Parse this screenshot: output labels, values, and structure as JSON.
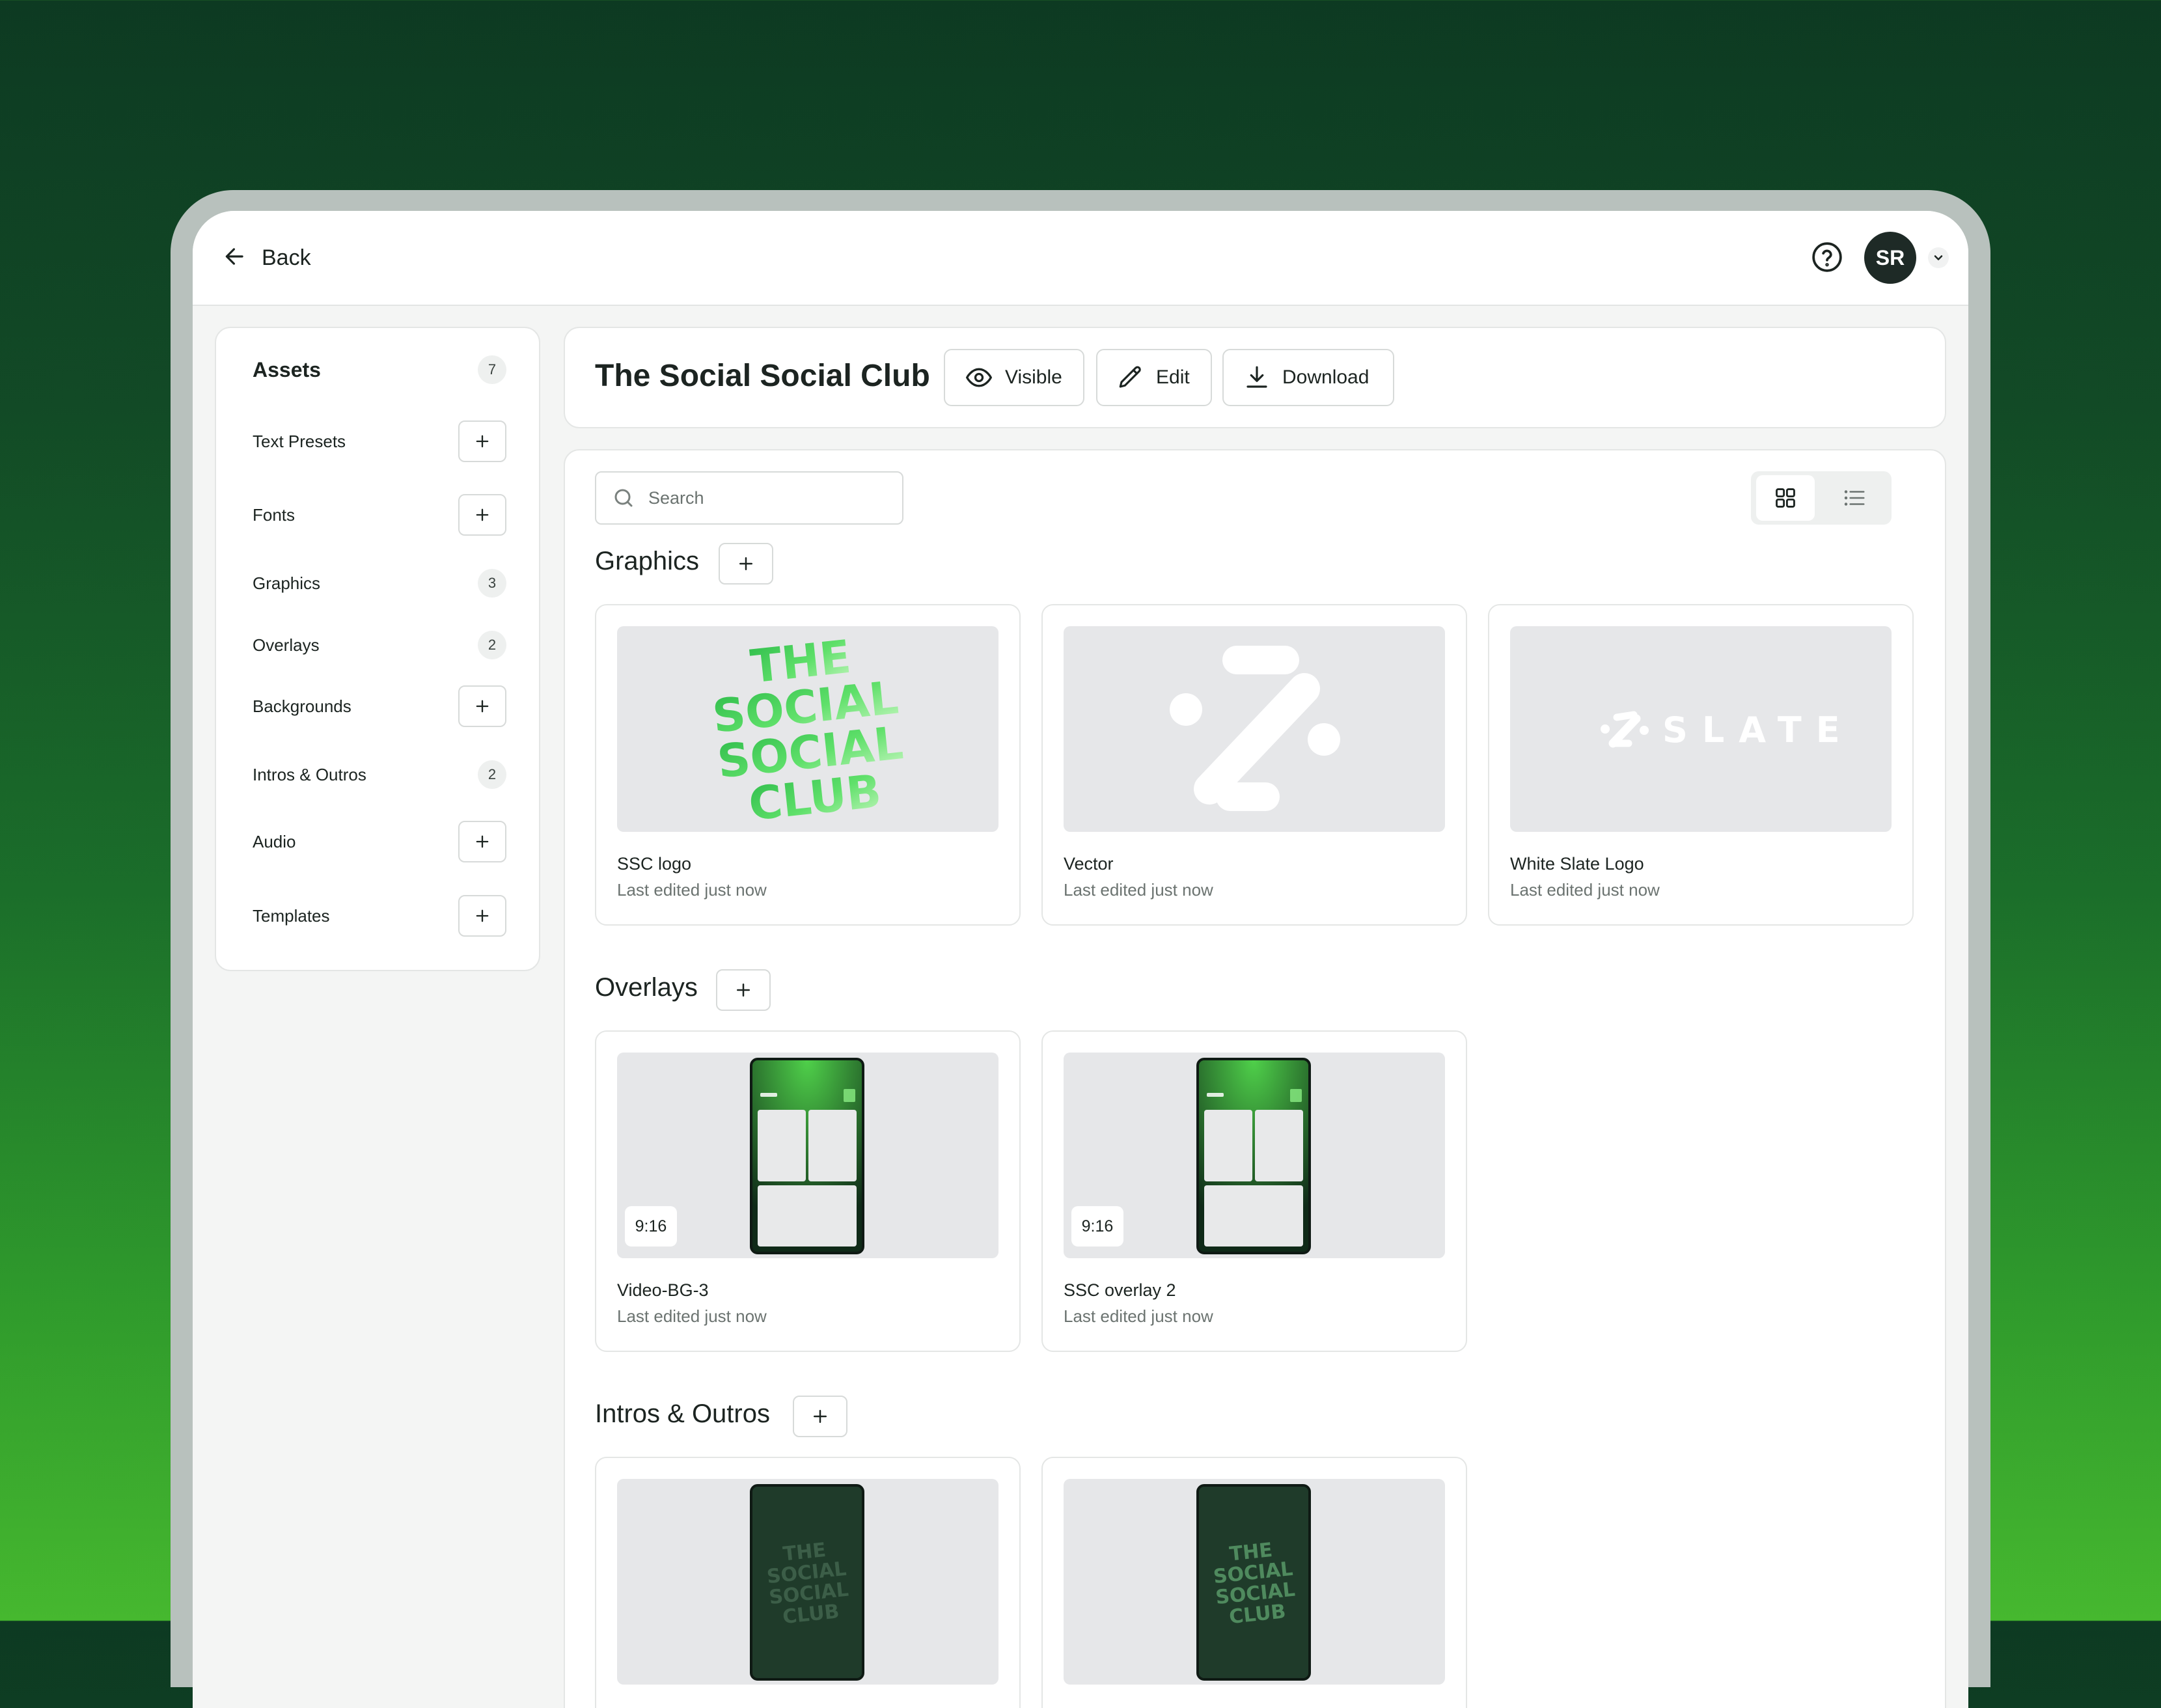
{
  "topbar": {
    "back_label": "Back",
    "avatar_initials": "SR"
  },
  "sidebar": {
    "title": "Assets",
    "count": "7",
    "items": [
      {
        "label": "Text Presets",
        "count": null
      },
      {
        "label": "Fonts",
        "count": null
      },
      {
        "label": "Graphics",
        "count": "3"
      },
      {
        "label": "Overlays",
        "count": "2"
      },
      {
        "label": "Backgrounds",
        "count": null
      },
      {
        "label": "Intros & Outros",
        "count": "2"
      },
      {
        "label": "Audio",
        "count": null
      },
      {
        "label": "Templates",
        "count": null
      }
    ]
  },
  "header": {
    "title": "The Social Social Club",
    "visible_label": "Visible",
    "edit_label": "Edit",
    "download_label": "Download"
  },
  "search": {
    "placeholder": "Search"
  },
  "sections": {
    "graphics": {
      "title": "Graphics",
      "cards": [
        {
          "name": "SSC logo",
          "meta": "Last edited just now",
          "thumb_lines": [
            "THE",
            "SOCIAL",
            "SOCIAL",
            "CLUB"
          ]
        },
        {
          "name": "Vector",
          "meta": "Last edited just now"
        },
        {
          "name": "White Slate Logo",
          "meta": "Last edited just now",
          "thumb_text": "SLATE"
        }
      ]
    },
    "overlays": {
      "title": "Overlays",
      "cards": [
        {
          "name": "Video-BG-3",
          "meta": "Last edited just now",
          "ratio": "9:16"
        },
        {
          "name": "SSC overlay 2",
          "meta": "Last edited just now",
          "ratio": "9:16"
        }
      ]
    },
    "intros": {
      "title": "Intros & Outros",
      "cards": [
        {
          "thumb_lines": [
            "THE",
            "SOCIAL",
            "SOCIAL",
            "CLUB"
          ]
        },
        {
          "thumb_lines": [
            "THE",
            "SOCIAL",
            "SOCIAL",
            "CLUB"
          ]
        }
      ]
    }
  },
  "colors": {
    "accent_green": "#3ec24a",
    "dark": "#1e2a26",
    "thumb_bg": "#e6e7e9"
  }
}
